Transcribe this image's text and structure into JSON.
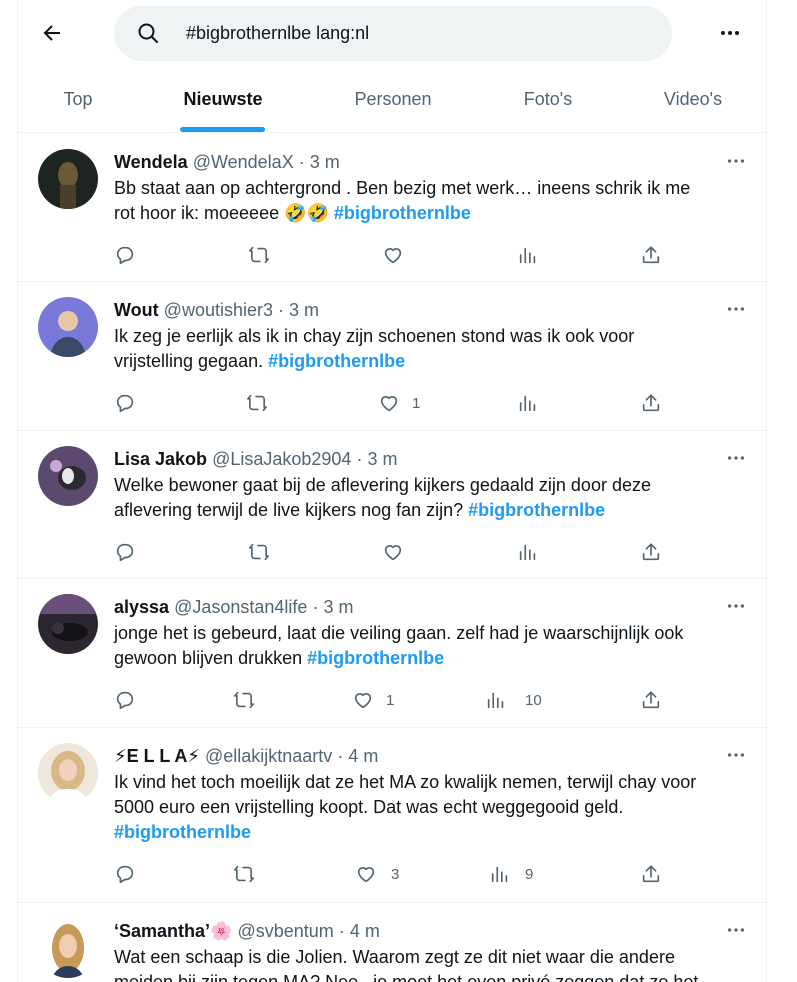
{
  "search": {
    "query": "#bigbrothernlbe lang:nl"
  },
  "tabs": [
    {
      "label": "Top"
    },
    {
      "label": "Nieuwste"
    },
    {
      "label": "Personen"
    },
    {
      "label": "Foto's"
    },
    {
      "label": "Video's"
    }
  ],
  "active_tab": "Nieuwste",
  "colors": {
    "accent": "#1d9bf0",
    "text": "#0f1419",
    "secondary": "#536471"
  },
  "tweets": [
    {
      "name": "Wendela",
      "handle": "@WendelaX",
      "sep": "·",
      "time": "3 m",
      "line1": "Bb staat aan op achtergrond . Ben bezig met werk… ineens schrik ik me",
      "line2": "rot hoor ik: moeeeee 🤣🤣 ",
      "hashtag": "#bigbrothernlbe",
      "likes": "",
      "views": ""
    },
    {
      "name": "Wout",
      "handle": "@woutishier3",
      "sep": "·",
      "time": "3 m",
      "line1": "Ik zeg je eerlijk als ik in chay zijn schoenen stond was ik ook voor",
      "line2": "vrijstelling gegaan. ",
      "hashtag": "#bigbrothernlbe",
      "likes": "1",
      "views": ""
    },
    {
      "name": "Lisa Jakob",
      "handle": "@LisaJakob2904",
      "sep": "·",
      "time": "3 m",
      "line1": "Welke bewoner gaat bij de aflevering kijkers gedaald zijn door deze",
      "line2": "aflevering terwijl de live kijkers nog fan zijn? ",
      "hashtag": "#bigbrothernlbe",
      "likes": "",
      "views": ""
    },
    {
      "name": "alyssa",
      "handle": "@Jasonstan4life",
      "sep": "·",
      "time": "3 m",
      "line1": "jonge het is gebeurd, laat die veiling gaan. zelf had je waarschijnlijk ook",
      "line2": "gewoon blijven drukken ",
      "hashtag": "#bigbrothernlbe",
      "likes": "1",
      "views": "10"
    },
    {
      "name": "⚡E L L A⚡",
      "handle": "@ellakijktnaartv",
      "sep": "·",
      "time": "4 m",
      "line1": "Ik vind het toch moeilijk dat ze het MA zo kwalijk nemen, terwijl chay voor",
      "line2": "5000 euro een vrijstelling koopt. Dat was echt weggegooid geld.",
      "hashtag": "#bigbrothernlbe",
      "likes": "3",
      "views": "9"
    },
    {
      "name": "‘Samantha’🌸",
      "handle": "@svbentum",
      "sep": "·",
      "time": "4 m",
      "line1": "Wat een schaap is die Jolien. Waarom zegt ze dit niet waar die andere",
      "line2": "meiden bij zijn tegen MA? Nee.. je moet het even privé zeggen dat ze het",
      "hashtag": "",
      "likes": "",
      "views": ""
    }
  ]
}
